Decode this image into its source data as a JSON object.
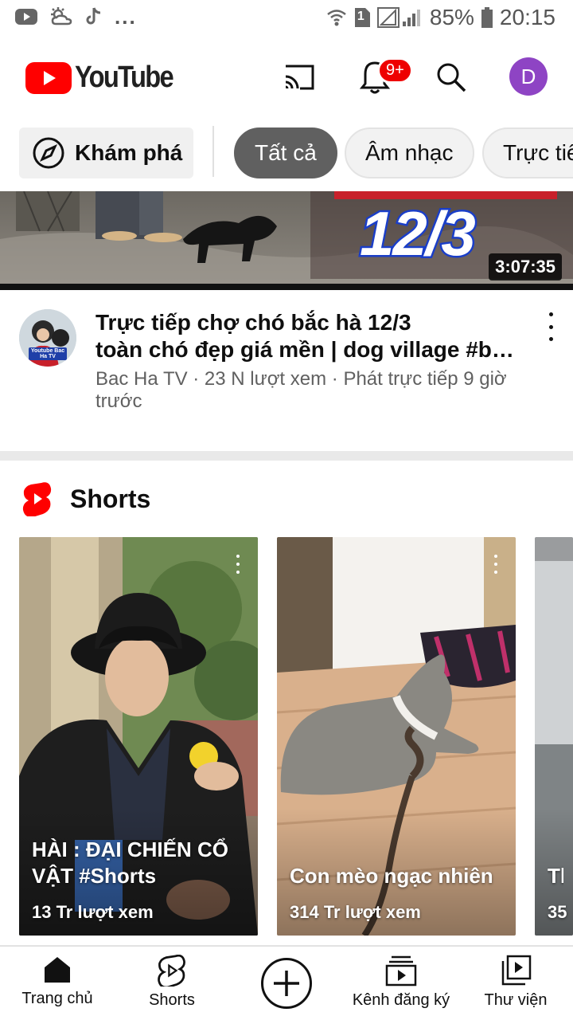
{
  "status_bar": {
    "battery": "85%",
    "time": "20:15",
    "sim_slot": "1",
    "overflow": "..."
  },
  "app_bar": {
    "logo_text": "YouTube",
    "notification_badge": "9+",
    "avatar_initial": "D",
    "brand_color": "#ff0000",
    "avatar_color": "#8e44c4"
  },
  "chips": {
    "explore_label": "Khám phá",
    "items": [
      {
        "label": "Tất cả",
        "selected": true
      },
      {
        "label": "Âm nhạc",
        "selected": false
      },
      {
        "label": "Trực tiế",
        "selected": false
      }
    ]
  },
  "video": {
    "thumbnail_text": "12/3",
    "duration": "3:07:35",
    "title_line1": "Trực tiếp chợ chó bắc hà 12/3",
    "title_line2": "toàn chó đẹp giá mền | dog village #bac…",
    "meta": "Bac Ha TV · 23 N lượt xem · Phát trực tiếp 9 giờ trước",
    "channel_avatar_text": "Youtube Bac Ha TV"
  },
  "shorts": {
    "heading": "Shorts",
    "items": [
      {
        "title": "HÀI : ĐẠI CHIẾN CỔ VẬT #Shorts",
        "views": "13 Tr lượt xem"
      },
      {
        "title": "Con mèo ngạc nhiên",
        "views": "314 Tr lượt xem"
      },
      {
        "title": "Th",
        "views": "35"
      }
    ]
  },
  "bottom_nav": {
    "items": [
      {
        "label": "Trang chủ",
        "icon": "home-icon",
        "active": true
      },
      {
        "label": "Shorts",
        "icon": "shorts-icon",
        "active": false
      },
      {
        "label": "",
        "icon": "create-icon",
        "active": false
      },
      {
        "label": "Kênh đăng ký",
        "icon": "subscriptions-icon",
        "active": false
      },
      {
        "label": "Thư viện",
        "icon": "library-icon",
        "active": false
      }
    ]
  }
}
